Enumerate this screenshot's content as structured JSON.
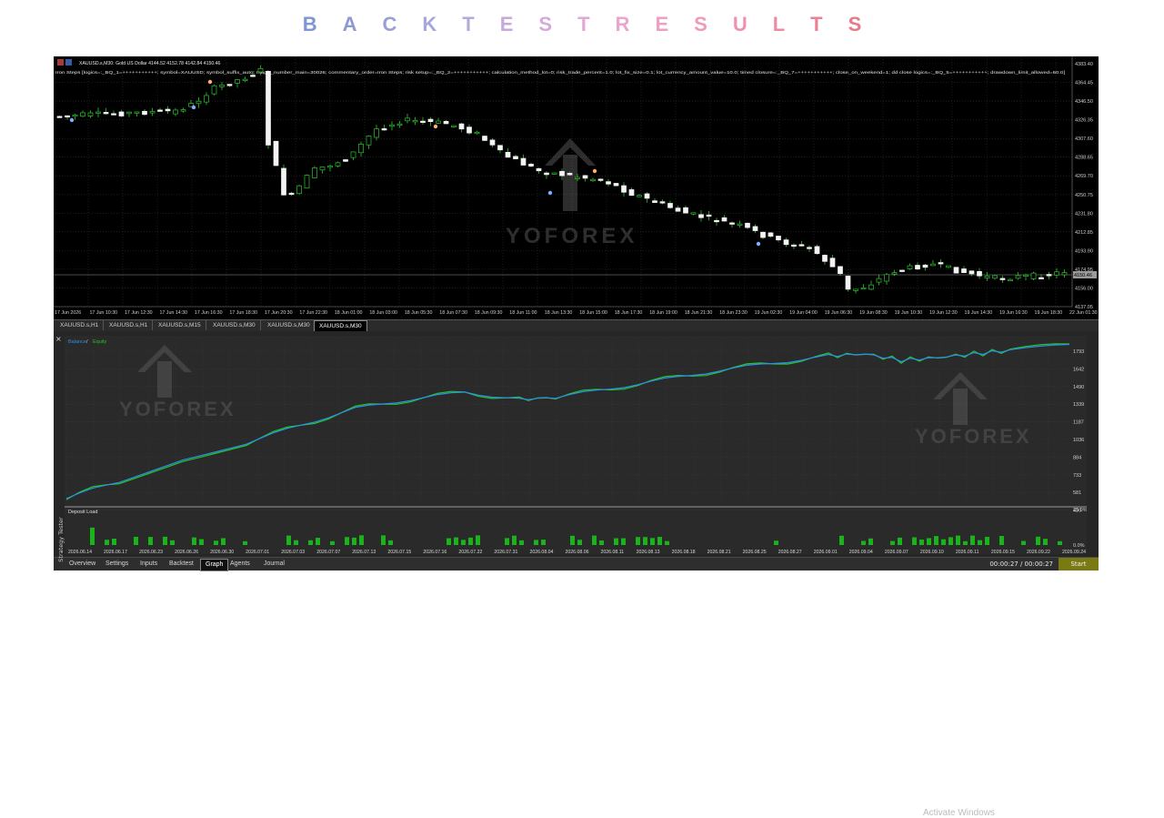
{
  "heading": {
    "letters": [
      "B",
      "A",
      "C",
      "K",
      "T",
      "E",
      "S",
      "T",
      "R",
      "E",
      "S",
      "U",
      "L",
      "T",
      "S"
    ],
    "colors": [
      "#7f95d4",
      "#8b99d6",
      "#99a0d8",
      "#a6a7dc",
      "#b6aadd",
      "#c7a9dc",
      "#d6a9da",
      "#e2a7d6",
      "#e9a4cf",
      "#eda0c4",
      "#ef9ab9",
      "#ef92ad",
      "#ee8ba1",
      "#ec8195",
      "#e9788a"
    ]
  },
  "price_chart": {
    "symbol_line": "XAUUSD.s,M30: Gold US Dollar  4144.52 4152.78 4142.84 4150.46",
    "ea_params": "Iron Steps [logics=:_BQ_1=+++++++++++; symbol=XAUUSD; symbol_suffix_auto; magic_number_main=30026; commentary_order=Iron Steps; risk setup=:_BQ_2=+++++++++++; calculation_method_lot=0; risk_trade_percent=1.0; lot_fix_size=0.1; lot_currency_amount_value=10.0; timed closure=:_BQ_7=+++++++++++; close_on_weekend=1; dd close logics=:_BQ_5=+++++++++++; drawdown_limit_allowed=60.0]",
    "price_labels": [
      "4383.40",
      "4364.45",
      "4346.50",
      "4326.35",
      "4307.60",
      "4288.65",
      "4269.70",
      "4250.75",
      "4231.80",
      "4212.85",
      "4193.90",
      "4174.95",
      "4156.00",
      "4137.05"
    ],
    "current_price": "4150.46",
    "time_labels": [
      "17 Jun 2026",
      "17 Jun 10:30",
      "17 Jun 12:30",
      "17 Jun 14:30",
      "17 Jun 16:30",
      "17 Jun 18:30",
      "17 Jun 20:30",
      "17 Jun 22:30",
      "18 Jun 01:00",
      "18 Jun 03:00",
      "18 Jun 05:30",
      "18 Jun 07:30",
      "18 Jun 09:30",
      "18 Jun 11:00",
      "18 Jun 13:30",
      "18 Jun 15:00",
      "18 Jun 17:30",
      "18 Jun 19:00",
      "18 Jun 21:30",
      "18 Jun 23:30",
      "19 Jun 02:30",
      "19 Jun 04:00",
      "19 Jun 06:30",
      "19 Jun 08:30",
      "19 Jun 10:30",
      "19 Jun 12:30",
      "19 Jun 14:30",
      "19 Jun 16:30",
      "19 Jun 18:30",
      "22 Jun 01:30"
    ],
    "watermark": "YOFOREX"
  },
  "chart_tabs": [
    "XAUUSD.s,H1",
    "XAUUSD.s,H1",
    "XAUUSD.s,M15",
    "XAUUSD.s,M30",
    "XAUUSD.s,M30",
    "XAUUSD.s,M30"
  ],
  "active_chart_tab": 5,
  "tester_graph": {
    "legend_balance": "Balance",
    "legend_sep": " / ",
    "legend_equity": "Equity",
    "y_labels": [
      "1793",
      "1642",
      "1490",
      "1339",
      "1187",
      "1036",
      "884",
      "733",
      "581",
      "430"
    ],
    "deposit_label": "Deposit Load",
    "deposit_pct": [
      "25.0%",
      "0.0%"
    ],
    "date_labels": [
      "2026.06.14",
      "2026.06.17",
      "2026.06.23",
      "2026.06.26",
      "2026.06.30",
      "2026.07.01",
      "2026.07.03",
      "2026.07.07",
      "2026.07.13",
      "2026.07.15",
      "2026.07.16",
      "2026.07.22",
      "2026.07.31",
      "2026.08.04",
      "2026.08.06",
      "2026.08.11",
      "2026.08.13",
      "2026.08.18",
      "2026.08.21",
      "2026.08.25",
      "2026.08.27",
      "2026.09.01",
      "2026.09.04",
      "2026.09.07",
      "2026.09.10",
      "2026.09.11",
      "2026.09.15",
      "2026.09.22",
      "2026.09.24"
    ],
    "colors": {
      "balance": "#2f8fe8",
      "equity": "#22c522",
      "deposit": "#1bb31b"
    }
  },
  "bottom_tabs": [
    "Overview",
    "Settings",
    "Inputs",
    "Backtest",
    "Graph",
    "Agents",
    "Journal"
  ],
  "active_bottom_tab": 4,
  "timer": "00:00:27 / 00:00:27",
  "start_label": "Start",
  "side_label": "Strategy Tester",
  "close_glyph": "×",
  "activate_windows": "Activate Windows"
}
